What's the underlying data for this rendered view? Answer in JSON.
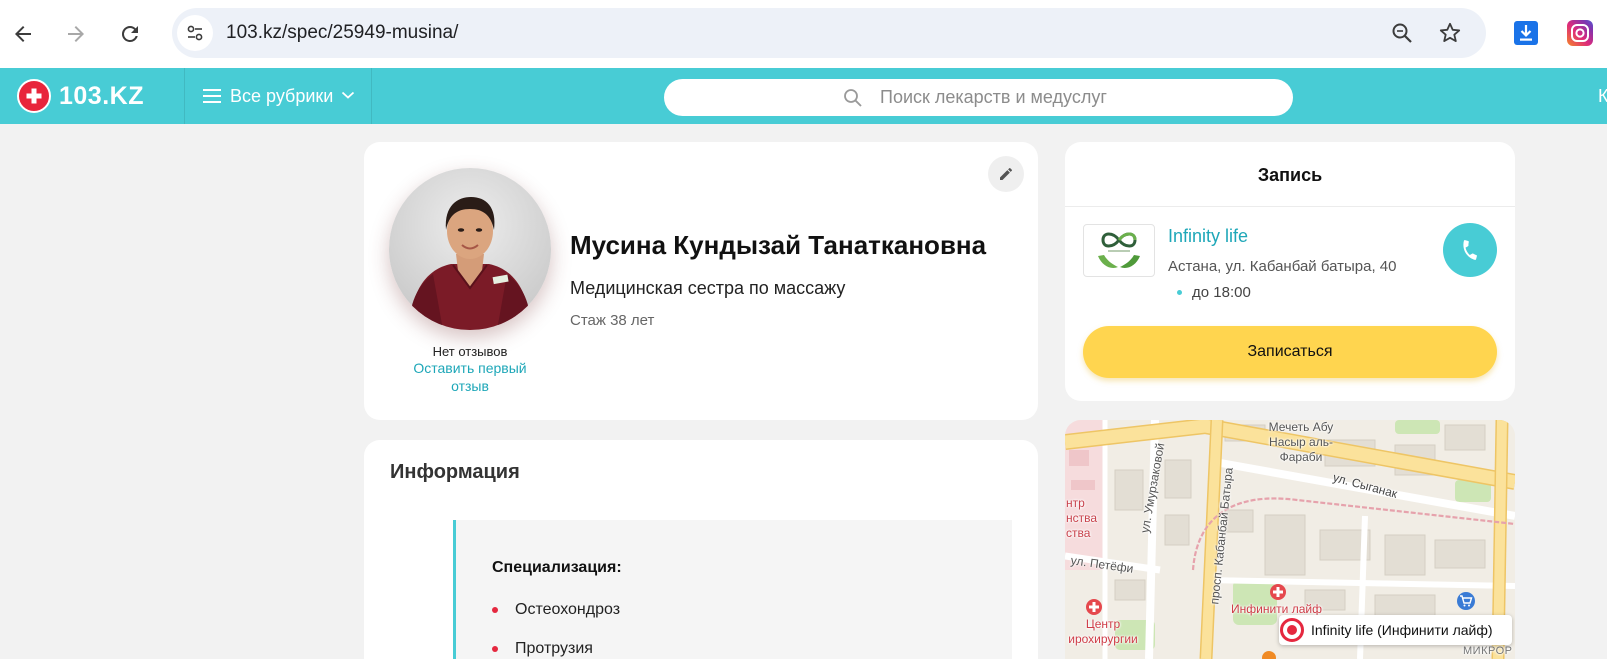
{
  "browser": {
    "url": "103.kz/spec/25949-musina/",
    "icons": [
      "back-arrow-icon",
      "forward-arrow-icon",
      "reload-icon",
      "site-settings-icon",
      "zoom-icon",
      "star-icon",
      "download-icon",
      "extension-icon"
    ]
  },
  "header": {
    "logo_text": "103.KZ",
    "rubrics_label": "Все рубрики",
    "search_placeholder": "Поиск лекарств и медуслуг",
    "cut_text": "К"
  },
  "doctor": {
    "name": "Мусина Кундызай Танаткановна",
    "position": "Медицинская сестра по массажу",
    "experience": "Стаж 38 лет",
    "reviews_status": "Нет отзывов",
    "leave_review_link": "Оставить первый отзыв"
  },
  "info": {
    "title": "Информация",
    "specialization_title": "Специализация:",
    "specializations": [
      "Остеохондроз",
      "Протрузия"
    ]
  },
  "booking": {
    "title": "Запись",
    "clinic_name": "Infinity life",
    "clinic_address": "Астана, ул. Кабанбай батыра, 40",
    "clinic_hours": "до 18:00",
    "button_label": "Записаться"
  },
  "map": {
    "mosque_lines": [
      "Мечеть Абу",
      "Насыр аль-",
      "Фараби"
    ],
    "street_syganak": "ул. Сыганак",
    "street_umurzakova": "ул. Умурзаковой",
    "street_kabanbai": "просп. Кабанбай Батыра",
    "street_petofi": "ул. Петёфи",
    "cut_left_lines": [
      "нтр",
      "нства",
      "ства"
    ],
    "poi_infinity": "Инфинити лайф",
    "poi_center_lines": [
      "Центр",
      "ирохирургии"
    ],
    "cut_bottom_right": "МИКРОР",
    "marker_label": "Infinity life (Инфинити лайф)"
  },
  "colors": {
    "header_teal": "#48ccd5",
    "link_teal": "#1ea7b8",
    "button_yellow": "#ffd54f",
    "bullet_red": "#e5283f",
    "logo_red": "#e8253b",
    "page_bg": "#f2f2f2"
  }
}
